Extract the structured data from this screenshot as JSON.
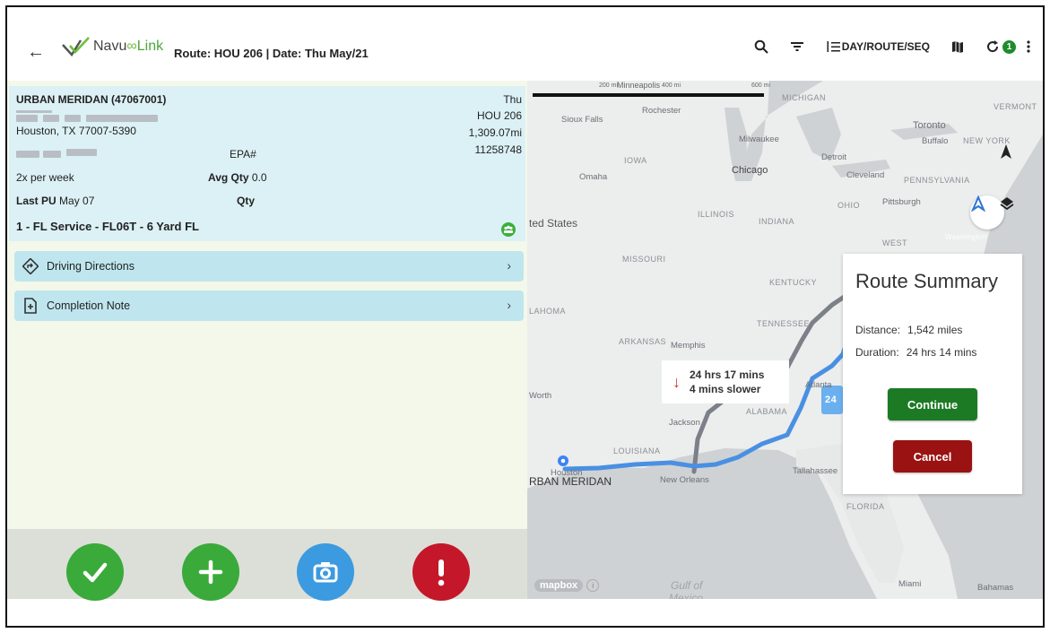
{
  "header": {
    "logo_navu": "Navu",
    "logo_inf": "∞",
    "logo_link": "Link",
    "route_title": "Route: HOU 206 | Date: Thu May/21",
    "sort_label": "DAY/ROUTE/SEQ",
    "badge_count": "1"
  },
  "stop": {
    "name": "URBAN MERIDAN (47067001)",
    "city_line": "Houston, TX 77007-5390",
    "day": "Thu",
    "route": "HOU 206",
    "distance": "1,309.07mi",
    "epa_label": "EPA#",
    "epa_value": "11258748",
    "frequency": "2x per week",
    "avg_qty_label": "Avg Qty",
    "avg_qty_value": "0.0",
    "last_pu_label": "Last PU",
    "last_pu_value": "May 07",
    "qty_label": "Qty",
    "service": "1 - FL Service - FL06T - 6 Yard FL"
  },
  "rows": {
    "driving_directions": "Driving Directions",
    "completion_note": "Completion Note"
  },
  "map": {
    "scale_left": "200 mi",
    "scale_city": "Minneapolis",
    "scale_mid": "400 mi",
    "scale_right": "600 mi",
    "labels": {
      "michigan": "MICHIGAN",
      "vermont": "VERMONT",
      "toronto": "Toronto",
      "buffalo": "Buffalo",
      "new_york": "NEW YORK",
      "sioux_falls": "Sioux Falls",
      "rochester": "Rochester",
      "milwaukee": "Milwaukee",
      "iowa": "IOWA",
      "chicago": "Chicago",
      "detroit": "Detroit",
      "cleveland": "Cleveland",
      "pennsylvania": "PENNSYLVANIA",
      "omaha": "Omaha",
      "ohio": "OHIO",
      "pittsburgh": "Pittsburgh",
      "illinois": "ILLINOIS",
      "indiana": "INDIANA",
      "united_states": "ted States",
      "missouri": "MISSOURI",
      "west": "WEST",
      "washington": "Washington",
      "kentucky": "KENTUCKY",
      "tennessee": "TENNESSEE",
      "oklahoma": "LAHOMA",
      "memphis": "Memphis",
      "arkansas": "ARKANSAS",
      "worth": "Worth",
      "atlanta": "Atlanta",
      "alabama": "ALABAMA",
      "jackson": "Jackson",
      "louisiana": "LOUISIANA",
      "houston": "Houston",
      "urban_meridan": "RBAN MERIDAN",
      "new_orleans": "New Orleans",
      "tallahassee": "Tallahassee",
      "florida": "FLORIDA",
      "gulf": "Gulf of",
      "mexico": "Mexico",
      "miami": "Miami",
      "bahamas": "Bahamas",
      "route_chip": "24"
    },
    "slower_time": "24 hrs 17 mins",
    "slower_delta": "4 mins slower",
    "attribution": "mapbox"
  },
  "summary": {
    "title": "Route Summary",
    "distance_label": "Distance:",
    "distance_value": "1,542  miles",
    "duration_label": "Duration:",
    "duration_value": "24 hrs 14 mins",
    "continue_label": "Continue",
    "cancel_label": "Cancel"
  },
  "colors": {
    "complete": "#3aaa3a",
    "add": "#3aaa3a",
    "camera": "#3b9ae0",
    "alert": "#c4172a",
    "route_blue": "#4a90e2",
    "route_gray": "#7c8088"
  }
}
